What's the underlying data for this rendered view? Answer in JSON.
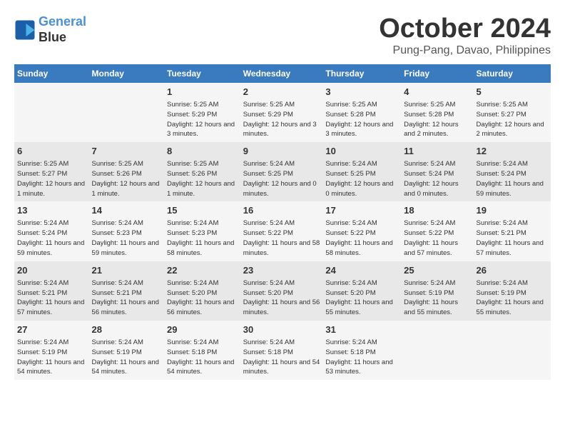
{
  "logo": {
    "line1": "General",
    "line2": "Blue"
  },
  "title": "October 2024",
  "location": "Pung-Pang, Davao, Philippines",
  "headers": [
    "Sunday",
    "Monday",
    "Tuesday",
    "Wednesday",
    "Thursday",
    "Friday",
    "Saturday"
  ],
  "weeks": [
    [
      {
        "day": "",
        "info": ""
      },
      {
        "day": "",
        "info": ""
      },
      {
        "day": "1",
        "info": "Sunrise: 5:25 AM\nSunset: 5:29 PM\nDaylight: 12 hours and 3 minutes."
      },
      {
        "day": "2",
        "info": "Sunrise: 5:25 AM\nSunset: 5:29 PM\nDaylight: 12 hours and 3 minutes."
      },
      {
        "day": "3",
        "info": "Sunrise: 5:25 AM\nSunset: 5:28 PM\nDaylight: 12 hours and 3 minutes."
      },
      {
        "day": "4",
        "info": "Sunrise: 5:25 AM\nSunset: 5:28 PM\nDaylight: 12 hours and 2 minutes."
      },
      {
        "day": "5",
        "info": "Sunrise: 5:25 AM\nSunset: 5:27 PM\nDaylight: 12 hours and 2 minutes."
      }
    ],
    [
      {
        "day": "6",
        "info": "Sunrise: 5:25 AM\nSunset: 5:27 PM\nDaylight: 12 hours and 1 minute."
      },
      {
        "day": "7",
        "info": "Sunrise: 5:25 AM\nSunset: 5:26 PM\nDaylight: 12 hours and 1 minute."
      },
      {
        "day": "8",
        "info": "Sunrise: 5:25 AM\nSunset: 5:26 PM\nDaylight: 12 hours and 1 minute."
      },
      {
        "day": "9",
        "info": "Sunrise: 5:24 AM\nSunset: 5:25 PM\nDaylight: 12 hours and 0 minutes."
      },
      {
        "day": "10",
        "info": "Sunrise: 5:24 AM\nSunset: 5:25 PM\nDaylight: 12 hours and 0 minutes."
      },
      {
        "day": "11",
        "info": "Sunrise: 5:24 AM\nSunset: 5:24 PM\nDaylight: 12 hours and 0 minutes."
      },
      {
        "day": "12",
        "info": "Sunrise: 5:24 AM\nSunset: 5:24 PM\nDaylight: 11 hours and 59 minutes."
      }
    ],
    [
      {
        "day": "13",
        "info": "Sunrise: 5:24 AM\nSunset: 5:24 PM\nDaylight: 11 hours and 59 minutes."
      },
      {
        "day": "14",
        "info": "Sunrise: 5:24 AM\nSunset: 5:23 PM\nDaylight: 11 hours and 59 minutes."
      },
      {
        "day": "15",
        "info": "Sunrise: 5:24 AM\nSunset: 5:23 PM\nDaylight: 11 hours and 58 minutes."
      },
      {
        "day": "16",
        "info": "Sunrise: 5:24 AM\nSunset: 5:22 PM\nDaylight: 11 hours and 58 minutes."
      },
      {
        "day": "17",
        "info": "Sunrise: 5:24 AM\nSunset: 5:22 PM\nDaylight: 11 hours and 58 minutes."
      },
      {
        "day": "18",
        "info": "Sunrise: 5:24 AM\nSunset: 5:22 PM\nDaylight: 11 hours and 57 minutes."
      },
      {
        "day": "19",
        "info": "Sunrise: 5:24 AM\nSunset: 5:21 PM\nDaylight: 11 hours and 57 minutes."
      }
    ],
    [
      {
        "day": "20",
        "info": "Sunrise: 5:24 AM\nSunset: 5:21 PM\nDaylight: 11 hours and 57 minutes."
      },
      {
        "day": "21",
        "info": "Sunrise: 5:24 AM\nSunset: 5:21 PM\nDaylight: 11 hours and 56 minutes."
      },
      {
        "day": "22",
        "info": "Sunrise: 5:24 AM\nSunset: 5:20 PM\nDaylight: 11 hours and 56 minutes."
      },
      {
        "day": "23",
        "info": "Sunrise: 5:24 AM\nSunset: 5:20 PM\nDaylight: 11 hours and 56 minutes."
      },
      {
        "day": "24",
        "info": "Sunrise: 5:24 AM\nSunset: 5:20 PM\nDaylight: 11 hours and 55 minutes."
      },
      {
        "day": "25",
        "info": "Sunrise: 5:24 AM\nSunset: 5:19 PM\nDaylight: 11 hours and 55 minutes."
      },
      {
        "day": "26",
        "info": "Sunrise: 5:24 AM\nSunset: 5:19 PM\nDaylight: 11 hours and 55 minutes."
      }
    ],
    [
      {
        "day": "27",
        "info": "Sunrise: 5:24 AM\nSunset: 5:19 PM\nDaylight: 11 hours and 54 minutes."
      },
      {
        "day": "28",
        "info": "Sunrise: 5:24 AM\nSunset: 5:19 PM\nDaylight: 11 hours and 54 minutes."
      },
      {
        "day": "29",
        "info": "Sunrise: 5:24 AM\nSunset: 5:18 PM\nDaylight: 11 hours and 54 minutes."
      },
      {
        "day": "30",
        "info": "Sunrise: 5:24 AM\nSunset: 5:18 PM\nDaylight: 11 hours and 54 minutes."
      },
      {
        "day": "31",
        "info": "Sunrise: 5:24 AM\nSunset: 5:18 PM\nDaylight: 11 hours and 53 minutes."
      },
      {
        "day": "",
        "info": ""
      },
      {
        "day": "",
        "info": ""
      }
    ]
  ]
}
